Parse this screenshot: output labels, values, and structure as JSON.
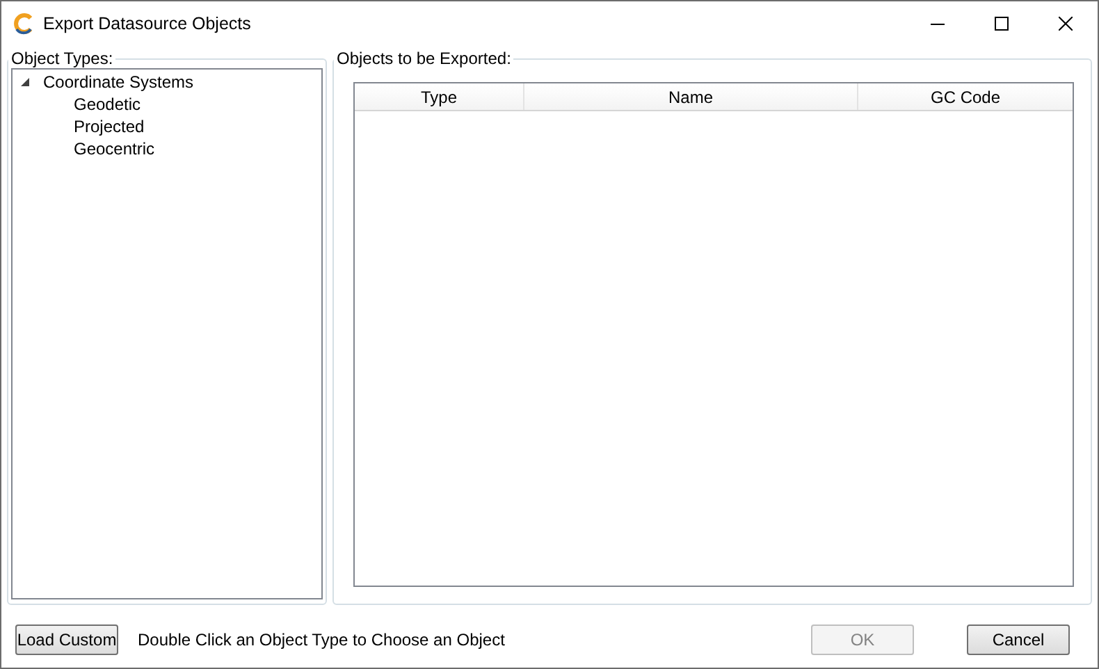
{
  "window": {
    "title": "Export Datasource Objects"
  },
  "object_types": {
    "label": "Object Types:",
    "tree": [
      {
        "label": "Coordinate Systems",
        "expanded": true,
        "children": [
          {
            "label": "Geodetic"
          },
          {
            "label": "Projected"
          },
          {
            "label": "Geocentric"
          }
        ]
      }
    ]
  },
  "objects_to_export": {
    "label": "Objects to be Exported:",
    "columns": [
      "Type",
      "Name",
      "GC Code"
    ]
  },
  "footer": {
    "load_button": "Load Custom",
    "hint": "Double Click an Object Type to Choose an Object",
    "ok": {
      "label": "OK",
      "disabled": true
    },
    "cancel": {
      "label": "Cancel",
      "disabled": false
    }
  }
}
